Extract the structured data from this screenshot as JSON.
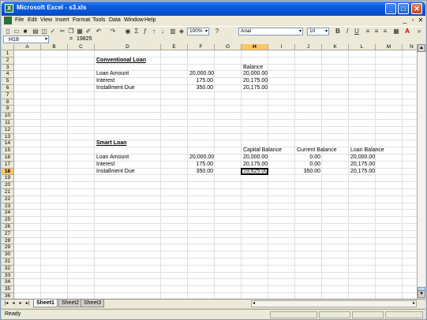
{
  "window": {
    "title": "Microsoft Excel - s3.xls"
  },
  "menu": [
    "File",
    "Edit",
    "View",
    "Insert",
    "Format",
    "Tools",
    "Data",
    "Window",
    "Help"
  ],
  "toolbar": {
    "zoom": "100%",
    "font": "Arial",
    "size": "10",
    "help_label": "?"
  },
  "formula": {
    "cell_ref": "H18",
    "fx": "=",
    "value": "19825"
  },
  "columns": [
    "A",
    "B",
    "C",
    "D",
    "E",
    "F",
    "G",
    "H",
    "I",
    "J",
    "K",
    "L",
    "M",
    "N"
  ],
  "selected_column": "H",
  "rows": [
    "1",
    "2",
    "3",
    "4",
    "5",
    "6",
    "7",
    "8",
    "9",
    "10",
    "11",
    "12",
    "13",
    "14",
    "15",
    "16",
    "17",
    "18",
    "19",
    "20",
    "21",
    "22",
    "23",
    "24",
    "25",
    "26",
    "27",
    "28",
    "29",
    "30",
    "31",
    "32",
    "33",
    "34",
    "35",
    "36"
  ],
  "selected_row": "18",
  "cells": {
    "d2": "Conventional Loan",
    "h3": "Balance",
    "d4": "Loan Amount",
    "f4": "20,000.00",
    "h4": "20,000.00",
    "d5": "Interest",
    "f5": "175.00",
    "h5": "20,175.00",
    "d6": "Installment Due",
    "f6": "350.00",
    "h6": "20,175.00",
    "d14": "Smart Loan",
    "h15": "Capital Balance",
    "j15": "Current Balance",
    "l15": "Loan Balance",
    "d16": "Loan Amount",
    "f16": "20,000.00",
    "h16": "20,000.00",
    "j16": "0.00",
    "l16": "20,000.00",
    "d17": "Interest",
    "f17": "175.00",
    "h17": "20,175.00",
    "j17": "0.00",
    "l17": "20,175.00",
    "d18": "Installment Due",
    "f18": "350.00",
    "h18": "19,825.00",
    "j18": "350.00",
    "l18": "20,175.00"
  },
  "sheets": [
    "Sheet1",
    "Sheet2",
    "Sheet3"
  ],
  "active_sheet": "Sheet1",
  "status": "Ready",
  "colors": {
    "title_bar": "#0553d6",
    "selection_header": "#ffc669"
  }
}
